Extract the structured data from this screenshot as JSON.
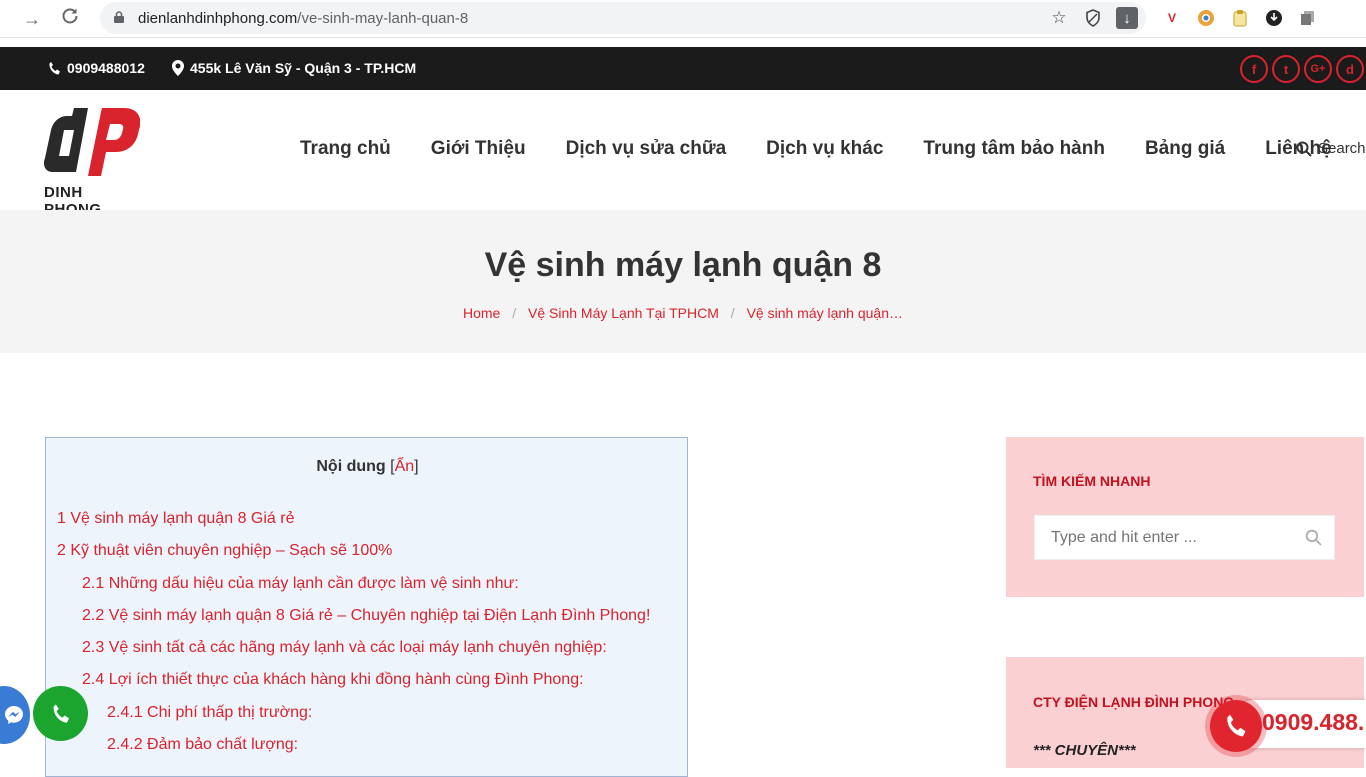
{
  "browser": {
    "url_domain": "dienlanhdinhphong.com",
    "url_path": "/ve-sinh-may-lanh-quan-8",
    "back_icon": "arrow-right-icon",
    "reload_icon": "reload-icon"
  },
  "topbar": {
    "phone": "0909488012",
    "address": "455k Lê Văn Sỹ - Quận 3 - TP.HCM",
    "social": [
      "f",
      "t",
      "G+",
      "d"
    ]
  },
  "header": {
    "logo_text": "DINH PHONG",
    "nav": [
      "Trang chủ",
      "Giới Thiệu",
      "Dịch vụ sửa chữa",
      "Dịch vụ khác",
      "Trung tâm bảo hành",
      "Bảng giá",
      "Liên hệ"
    ],
    "search_label": "Search"
  },
  "title_section": {
    "title": "Vệ sinh máy lạnh quận 8",
    "breadcrumb": {
      "home": "Home",
      "category": "Vệ Sinh Máy Lạnh Tại TPHCM",
      "current": "Vệ sinh máy lạnh quận…",
      "separator": "/"
    }
  },
  "toc": {
    "title": "Nội dung",
    "toggle_open": "[",
    "toggle_label": "Ẩn",
    "toggle_close": "]",
    "items": [
      "1 Vệ sinh máy lạnh quận 8 Giá rẻ",
      "2 Kỹ thuật viên chuyên nghiệp – Sạch sẽ 100%",
      "2.1 Những dấu hiệu của máy lạnh cần được làm vệ sinh như:",
      "2.2 Vệ sinh máy lạnh quận 8 Giá rẻ – Chuyên nghiệp tại Điện Lạnh Đình Phong!",
      "2.3 Vệ sinh tất cả các hãng máy lạnh và các loại máy lạnh chuyên nghiệp:",
      "2.4 Lợi ích thiết thực của khách hàng khi đồng hành cùng Đình Phong:",
      "2.4.1 Chi phí thấp thị trường:",
      "2.4.2 Đảm bảo chất lượng:"
    ]
  },
  "sidebar": {
    "search_widget_title": "TÌM KIẾM NHANH",
    "search_placeholder": "Type and hit enter ...",
    "company_widget_title": "CTY ĐIỆN LẠNH ĐÌNH PHONG",
    "company_tagline": "*** CHUYÊN***"
  },
  "floating": {
    "hotline": "0909.488."
  },
  "colors": {
    "accent": "#d9232d",
    "topbar_bg": "#1b1b1b",
    "sidebar_bg": "#fbd0d2",
    "toc_bg": "#eef4fb"
  }
}
